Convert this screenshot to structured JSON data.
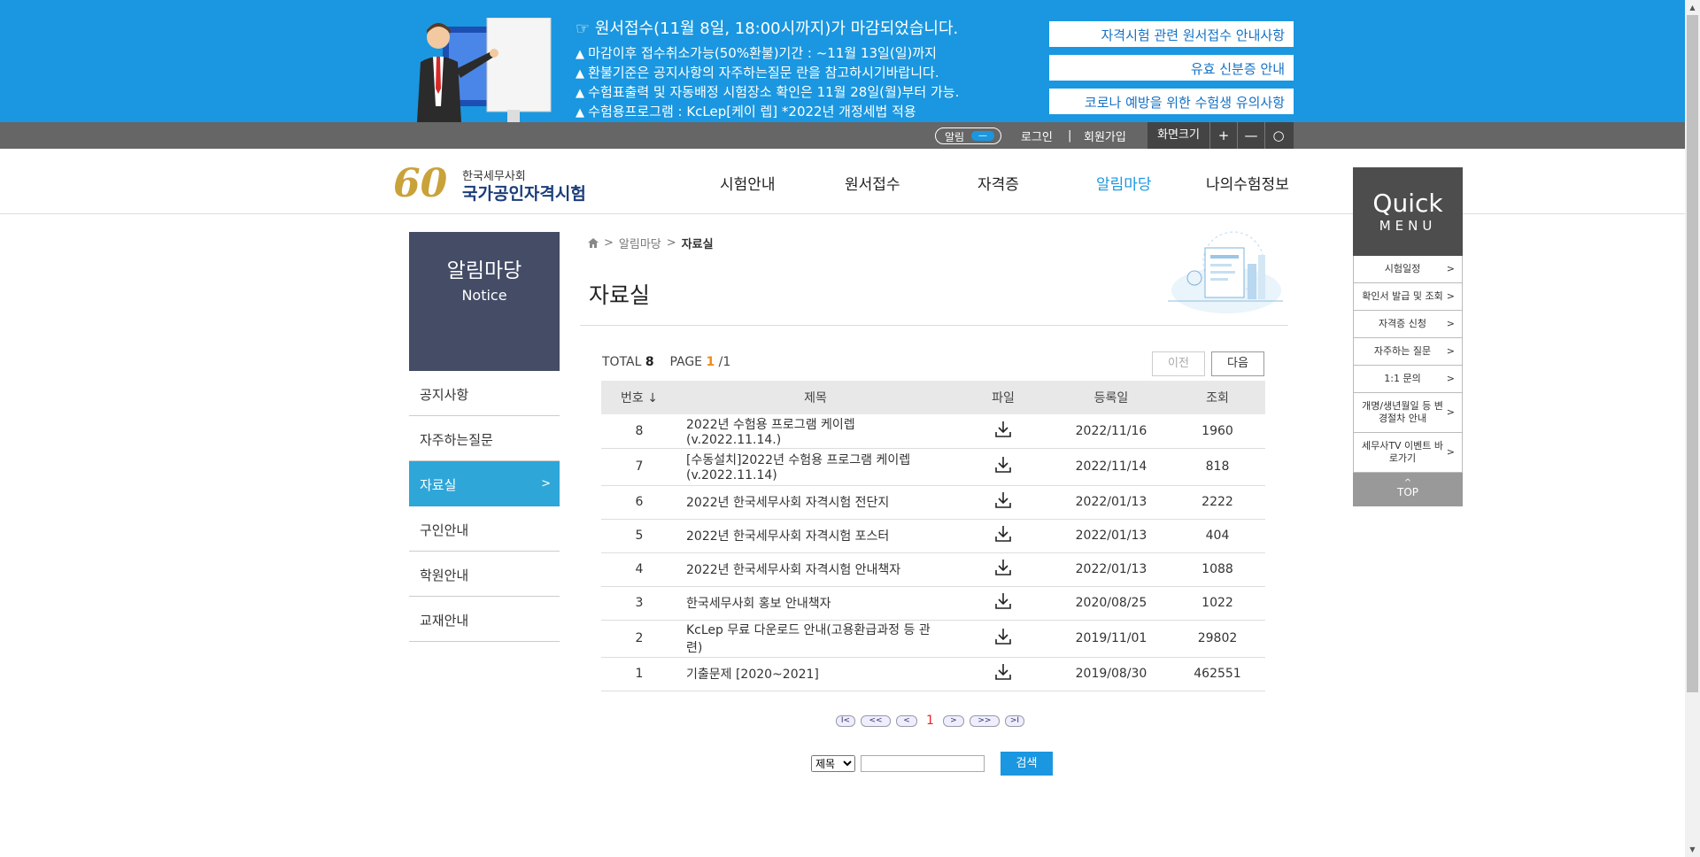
{
  "banner": {
    "headline": "☞ 원서접수(11월 8일, 18:00시까지)가 마감되었습니다.",
    "lines": [
      "마감이후 접수취소가능(50%환불)기간 : ~11월 13일(일)까지",
      "환불기준은 공지사항의 자주하는질문 란을 참고하시기바랍니다.",
      "수험표출력 및 자동배정 시험장소 확인은 11월 28일(월)부터 가능.",
      "수험용프로그램 : KcLep[케이 렙] *2022년 개정세법 적용"
    ],
    "buttons": [
      "자격시험 관련 원서접수 안내사항",
      "유효 신분증 안내",
      "코로나 예방을 위한 수험생 유의사항"
    ]
  },
  "util": {
    "alarm": "알림",
    "alarm_toggle": "—",
    "login": "로그인",
    "separator": "|",
    "join": "회원가입",
    "screen_size": "화면크기",
    "plus": "+",
    "minus": "—",
    "reset": "○"
  },
  "logo": {
    "number": "60",
    "org": "한국세무사회",
    "name": "국가공인자격시험"
  },
  "nav": [
    "시험안내",
    "원서접수",
    "자격증",
    "알림마당",
    "나의수험정보"
  ],
  "quick": {
    "title": "Quick",
    "subtitle": "MENU",
    "items": [
      "시험일정",
      "확인서 발급 및 조회",
      "자격증 신청",
      "자주하는 질문",
      "1:1 문의",
      "개명/생년월일 등 변경절차 안내",
      "세무사TV 이벤트 바로가기"
    ],
    "arrow": ">",
    "top": "TOP",
    "top_arrow": "^"
  },
  "sidebar": {
    "title": "알림마당",
    "subtitle": "Notice",
    "items": [
      "공지사항",
      "자주하는질문",
      "자료실",
      "구인안내",
      "학원안내",
      "교재안내"
    ],
    "active_arrow": ">"
  },
  "breadcrumb": {
    "sep": ">",
    "parent": "알림마당",
    "current": "자료실"
  },
  "page_title": "자료실",
  "summary": {
    "total_label": "TOTAL",
    "total": "8",
    "page_label": "PAGE",
    "page": "1",
    "pages": "/1"
  },
  "pager_buttons": {
    "prev": "이전",
    "next": "다음"
  },
  "table": {
    "headers": [
      "번호 ↓",
      "제목",
      "파일",
      "등록일",
      "조회"
    ],
    "rows": [
      {
        "no": "8",
        "title": "2022년 수험용 프로그램 케이렙(v.2022.11.14.)",
        "date": "2022/11/16",
        "views": "1960"
      },
      {
        "no": "7",
        "title": "[수동설치]2022년 수험용 프로그램 케이렙(v.2022.11.14)",
        "date": "2022/11/14",
        "views": "818"
      },
      {
        "no": "6",
        "title": "2022년 한국세무사회 자격시험 전단지",
        "date": "2022/01/13",
        "views": "2222"
      },
      {
        "no": "5",
        "title": "2022년 한국세무사회 자격시험 포스터",
        "date": "2022/01/13",
        "views": "404"
      },
      {
        "no": "4",
        "title": "2022년 한국세무사회 자격시험 안내책자",
        "date": "2022/01/13",
        "views": "1088"
      },
      {
        "no": "3",
        "title": "한국세무사회 홍보 안내책자",
        "date": "2020/08/25",
        "views": "1022"
      },
      {
        "no": "2",
        "title": "KcLep 무료 다운로드 안내(고용환급과정 등 관련)",
        "date": "2019/11/01",
        "views": "29802"
      },
      {
        "no": "1",
        "title": "기출문제 [2020~2021]",
        "date": "2019/08/30",
        "views": "462551"
      }
    ]
  },
  "paging": {
    "first": "I<",
    "prev10": "<<",
    "prev": "<",
    "current": "1",
    "next": ">",
    "next10": ">>",
    "last": ">I"
  },
  "search": {
    "field_selected": "제목",
    "button": "검색"
  },
  "colors": {
    "banner_blue": "#1a97e0",
    "sidebar_navy": "#444c66",
    "active_blue": "#2fa6d8",
    "page_orange": "#f08a1c"
  }
}
